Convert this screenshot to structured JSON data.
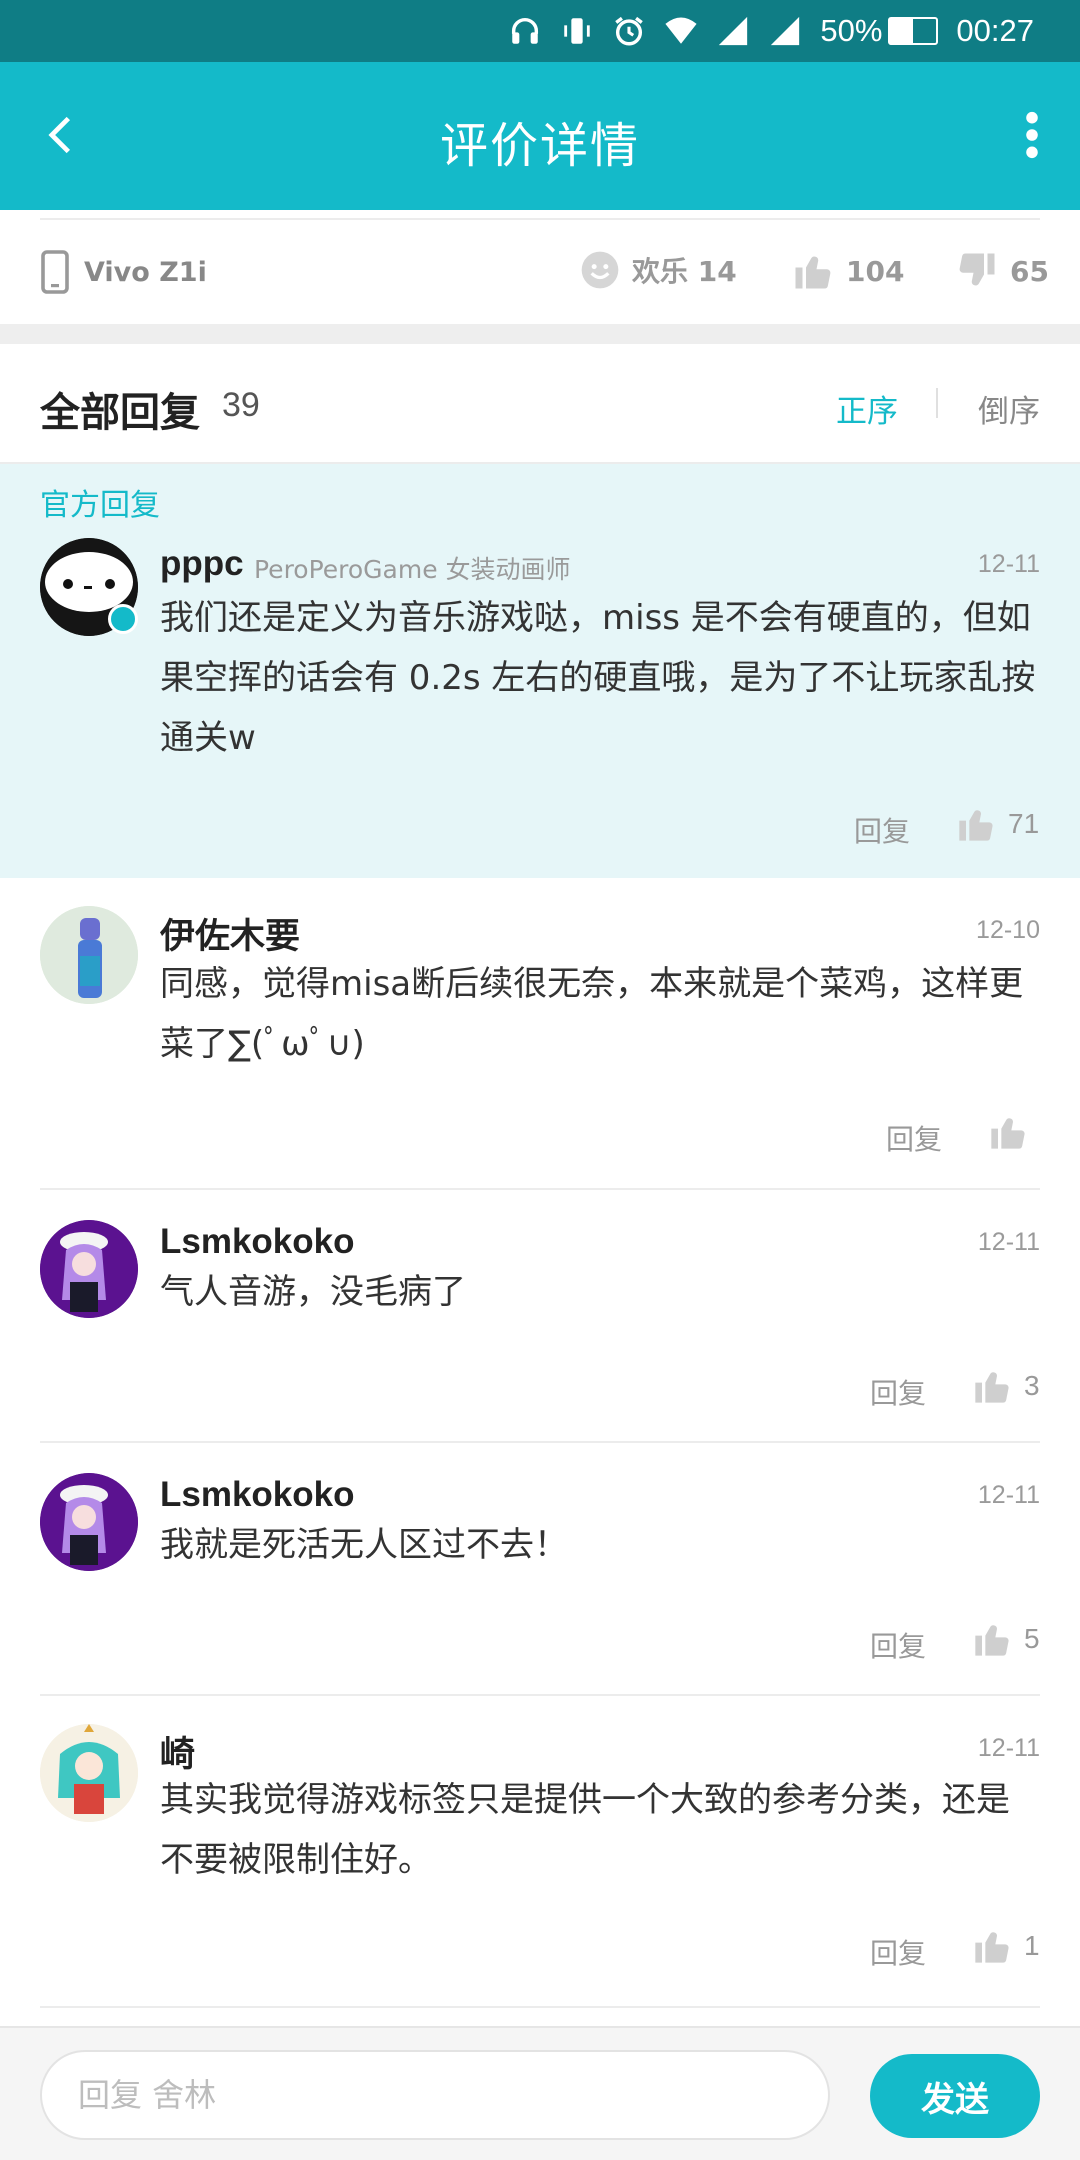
{
  "status_bar": {
    "battery": "50%",
    "battery_fraction": 0.5,
    "time": "00:27"
  },
  "app_bar": {
    "title": "评价详情"
  },
  "review_meta": {
    "device": "Vivo Z1i",
    "fun_label": "欢乐 14",
    "likes": "104",
    "dislikes": "65"
  },
  "replies_header": {
    "title": "全部回复",
    "count": "39",
    "sort_asc": "正序",
    "sort_desc": "倒序"
  },
  "official": {
    "label": "官方回复",
    "name": "pppc",
    "tag": "PeroPeroGame 女装动画师",
    "date": "12-11",
    "text": "我们还是定义为音乐游戏哒，miss 是不会有硬直的，但如果空挥的话会有 0.2s 左右的硬直哦，是为了不让玩家乱按通关w",
    "reply_label": "回复",
    "likes": "71"
  },
  "comments": [
    {
      "name": "伊佐木要",
      "date": "12-10",
      "text": "同感，觉得misa断后续很无奈，本来就是个菜鸡，这样更菜了∑(ﾟωﾟ∪)",
      "reply_label": "回复",
      "likes": ""
    },
    {
      "name": "Lsmkokoko",
      "date": "12-11",
      "text": "气人音游，没毛病了",
      "reply_label": "回复",
      "likes": "3"
    },
    {
      "name": "Lsmkokoko",
      "date": "12-11",
      "text": "我就是死活无人区过不去！",
      "reply_label": "回复",
      "likes": "5"
    },
    {
      "name": "崎",
      "date": "12-11",
      "text": "其实我觉得游戏标签只是提供一个大致的参考分类，还是不要被限制住好。",
      "reply_label": "回复",
      "likes": "1"
    }
  ],
  "bottom_bar": {
    "placeholder": "回复 舍林",
    "send_label": "发送"
  },
  "colors": {
    "accent": "#14bac9",
    "status_bar": "#0f7d85",
    "official_bg": "#e6f6f8"
  }
}
